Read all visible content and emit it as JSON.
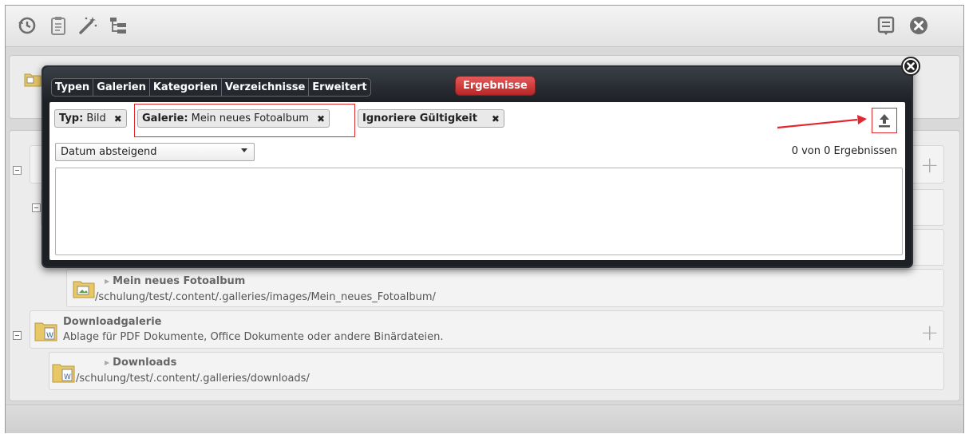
{
  "toolbar": {
    "icons": [
      "history-icon",
      "clipboard-icon",
      "magic-wand-icon",
      "tree-icon",
      "publish-list-icon",
      "exit-icon"
    ]
  },
  "dialog": {
    "tabs": [
      "Typen",
      "Galerien",
      "Kategorien",
      "Verzeichnisse",
      "Erweitert"
    ],
    "active_tab": "Ergebnisse",
    "filters": {
      "type_label": "Typ:",
      "type_value": "Bild",
      "gallery_label": "Galerie:",
      "gallery_value": "Mein neues Fotoalbum",
      "ignore_label": "Ignoriere Gültigkeit"
    },
    "sort": {
      "selected": "Datum absteigend"
    },
    "result_count": "0 von 0 Ergebnissen"
  },
  "background": {
    "image_gallery_title": "Mein neues Fotoalbum",
    "image_gallery_path": "/schulung/test/.content/.galleries/images/Mein_neues_Fotoalbum/",
    "download_gallery_title": "Downloadgalerie",
    "download_gallery_desc": "Ablage für PDF Dokumente, Office Dokumente oder andere Binärdateien.",
    "downloads_title": "Downloads",
    "downloads_path": "/schulung/test/.content/.galleries/downloads/"
  },
  "colors": {
    "active_tab": "#c83232",
    "highlight": "#e0282e"
  }
}
